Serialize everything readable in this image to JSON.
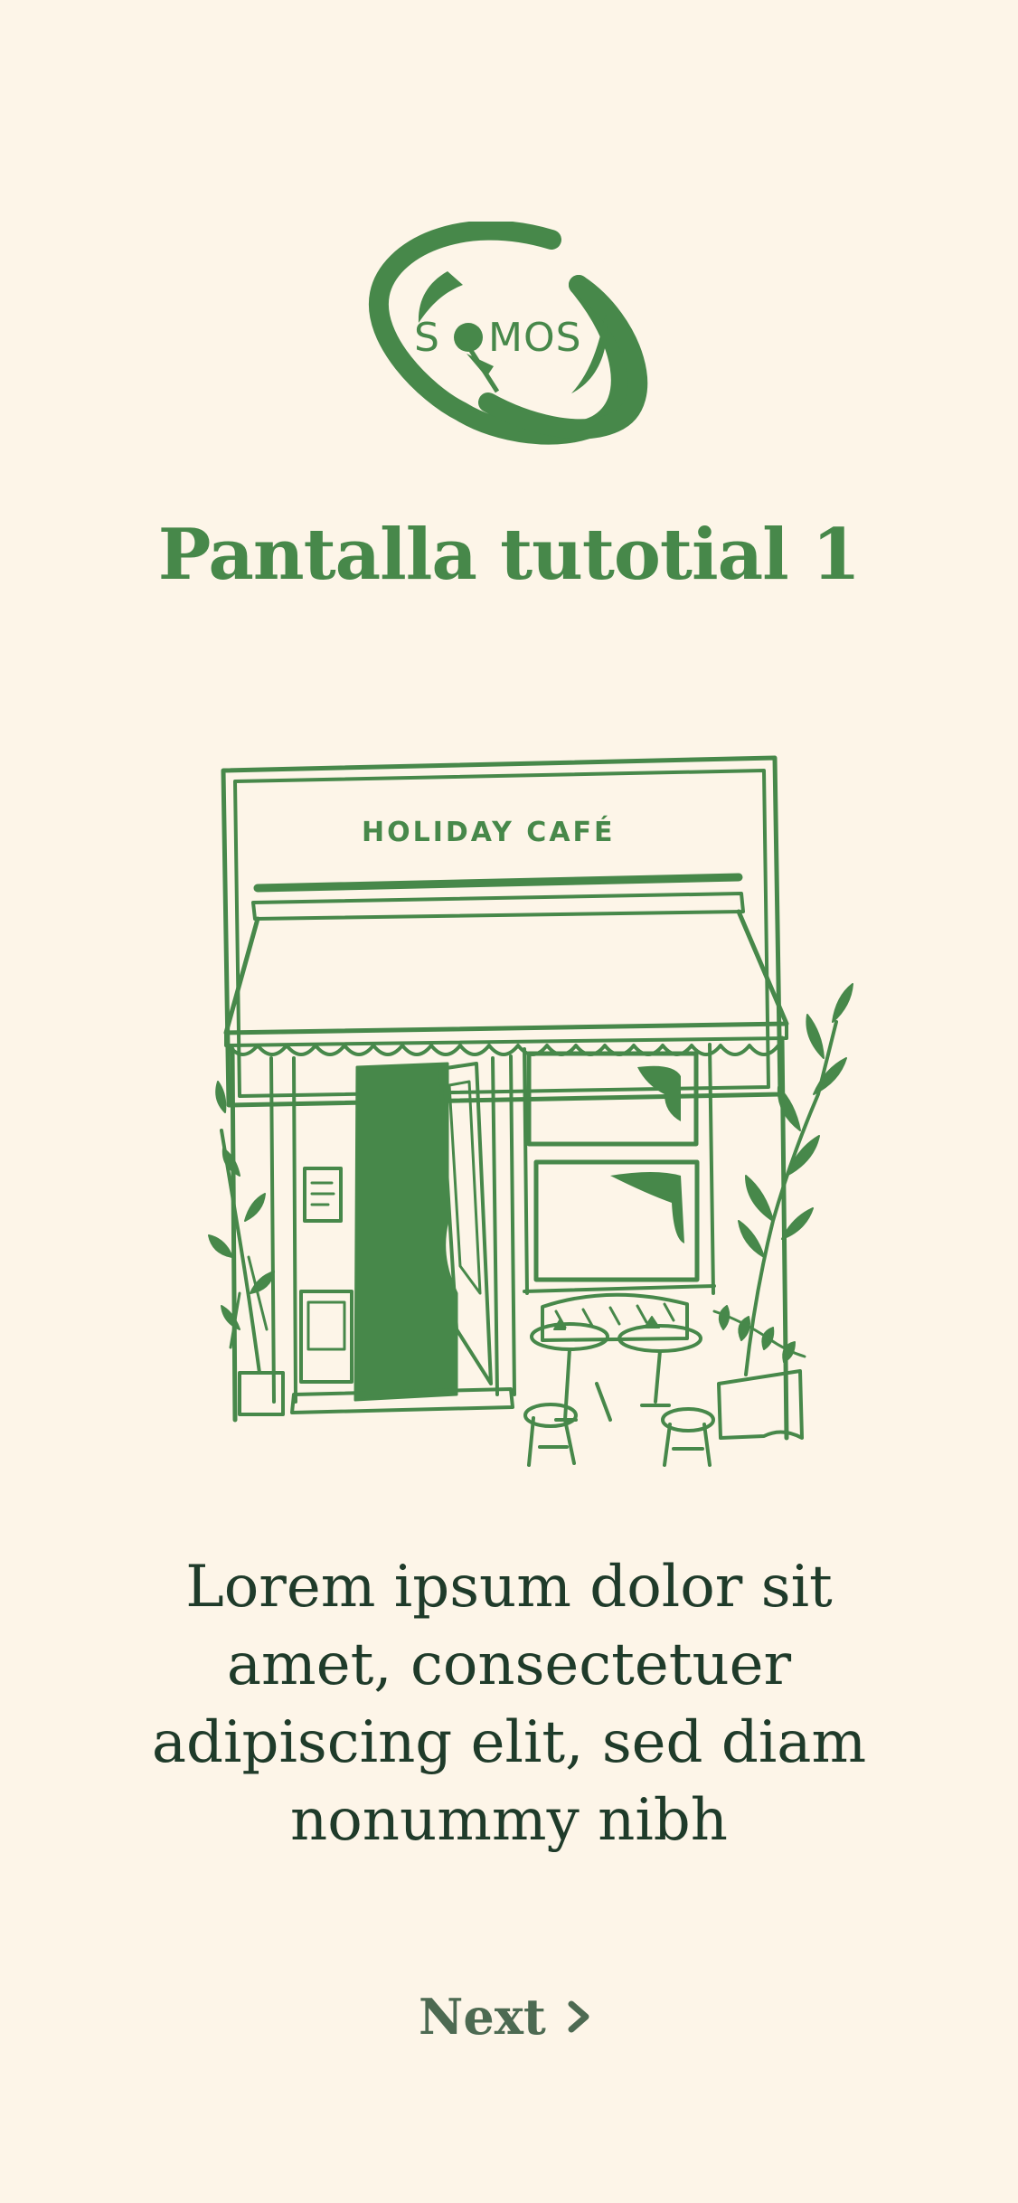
{
  "logo": {
    "text": "SOMOS",
    "icon": "somos-planet-logo-icon"
  },
  "screen": {
    "title": "Pantalla tutotial 1"
  },
  "illustration": {
    "sign_text": "HOLIDAY CAFÉ",
    "icon": "cafe-storefront-illustration"
  },
  "content": {
    "description": "Lorem ipsum dolor sit amet, consectetuer adipiscing elit, sed diam nonummy nibh"
  },
  "navigation": {
    "next_label": "Next",
    "next_icon": "chevron-right-icon"
  },
  "colors": {
    "background": "#fdf5e8",
    "brand_green": "#47884a",
    "body_text": "#1f3b2a",
    "next_text": "#4d6a52"
  }
}
